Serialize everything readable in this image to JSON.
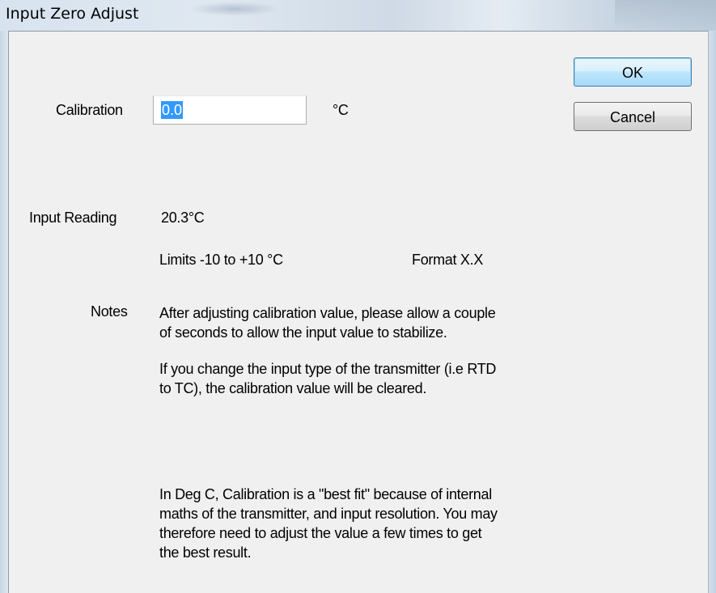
{
  "window": {
    "title": "Input Zero Adjust"
  },
  "buttons": {
    "ok": "OK",
    "cancel": "Cancel"
  },
  "calibration": {
    "label": "Calibration",
    "value": "0.0",
    "unit": "°C"
  },
  "reading": {
    "label": "Input Reading",
    "value": "20.3°C"
  },
  "limits": "Limits -10 to +10 °C",
  "format": "Format X.X",
  "notes": {
    "label": "Notes",
    "note1": [
      "After adjusting calibration value, please allow a couple",
      "of seconds to allow the input value to stabilize."
    ],
    "note2": [
      "If you change the input type of the transmitter (i.e RTD",
      "to TC), the calibration value will be cleared."
    ],
    "note3": [
      "In Deg C, Calibration is a \"best fit\" because of internal",
      "maths of the transmitter, and input resolution. You may",
      "therefore need to adjust the value a few times to get",
      "the best result."
    ]
  },
  "colors": {
    "selection": "#3399ff",
    "dialog_bg": "#f0f0f0",
    "default_button_border": "#3c7fb1"
  }
}
